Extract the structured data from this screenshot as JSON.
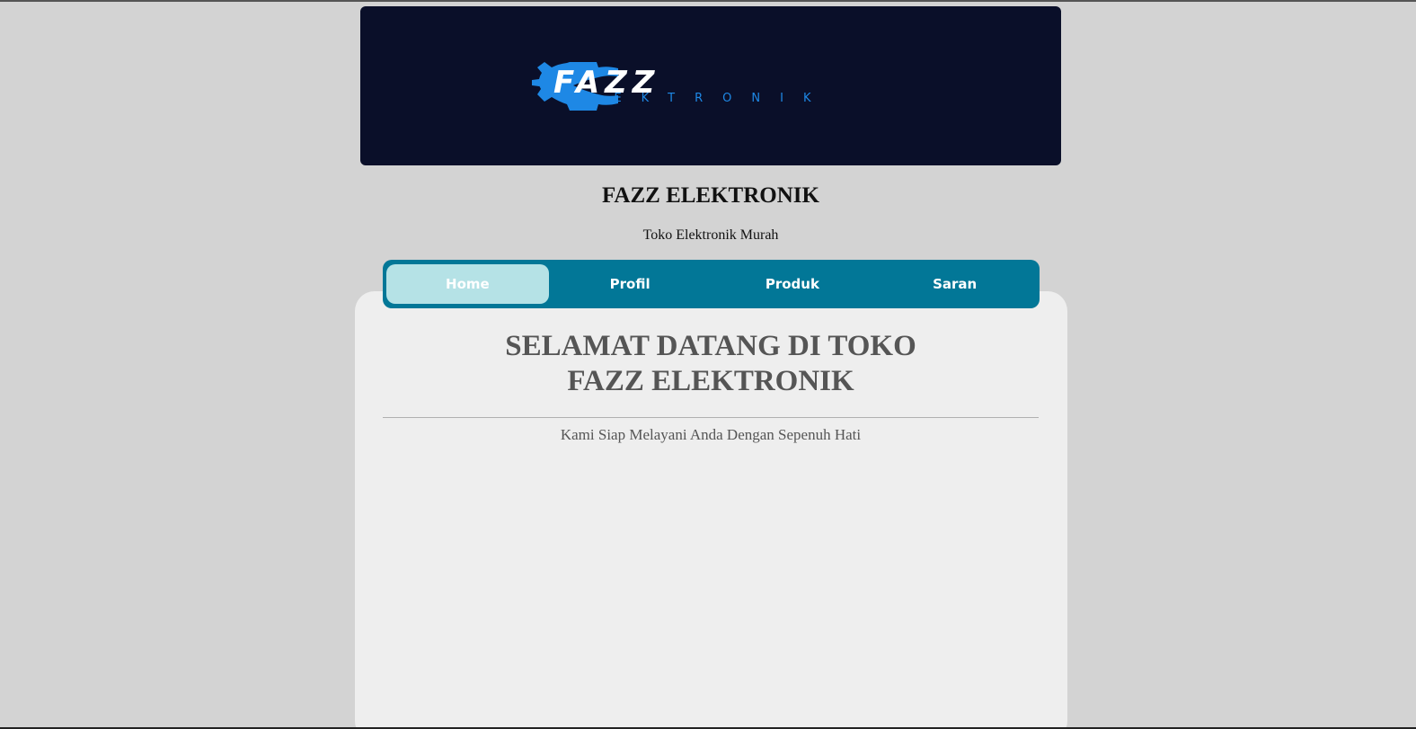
{
  "header": {
    "logo": {
      "icon": "gear-icon",
      "word_main": "FAZZ",
      "word_sub": "ELEKTRONIK",
      "colors": {
        "background": "#0a0f29",
        "gear": "#1e88e5",
        "text": "#ffffff"
      }
    },
    "title": "FAZZ ELEKTRONIK",
    "tagline": "Toko Elektronik Murah"
  },
  "nav": {
    "items": [
      {
        "label": "Home",
        "active": true
      },
      {
        "label": "Profil",
        "active": false
      },
      {
        "label": "Produk",
        "active": false
      },
      {
        "label": "Saran",
        "active": false
      }
    ],
    "colors": {
      "bar": "#027797",
      "active": "#b5e2e6"
    }
  },
  "main": {
    "heading_line1": "SELAMAT DATANG DI TOKO",
    "heading_line2": "FAZZ ELEKTRONIK",
    "subtitle": "Kami Siap Melayani Anda Dengan Sepenuh Hati"
  }
}
